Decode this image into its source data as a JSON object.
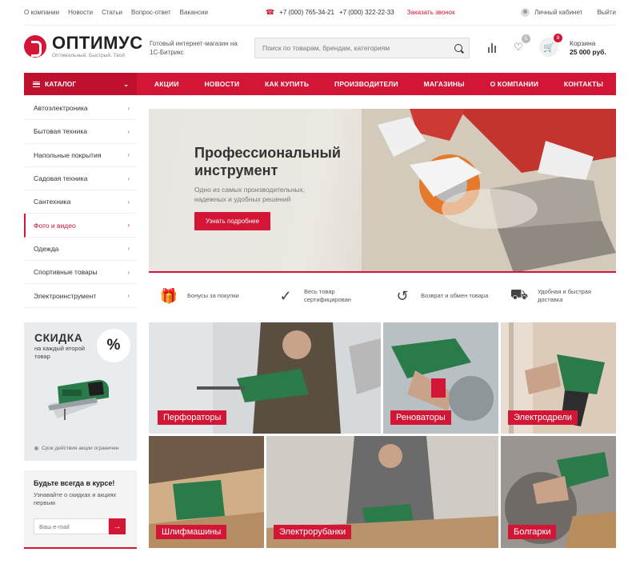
{
  "topbar": {
    "links": [
      "О компании",
      "Новости",
      "Статьи",
      "Вопрос-ответ",
      "Вакансии"
    ],
    "phone1": "+7 (000) 765-34-21",
    "phone2": "+7 (000) 322-22-33",
    "callback": "Заказать звонок",
    "account": "Личный кабинет",
    "logout": "Выйти"
  },
  "header": {
    "logo_name": "ОПТИМУС",
    "logo_slogan": "Оптимальный. Быстрый. Твой",
    "description": "Готовый интернет-магазин на 1С-Битрикс",
    "search_placeholder": "Поиск по товарам, брендам, категориям",
    "fav_count": "5",
    "cart_count": "8",
    "cart_label": "Корзина",
    "cart_total": "25 000 руб."
  },
  "nav": {
    "catalog": "КАТАЛОГ",
    "items": [
      "АКЦИИ",
      "НОВОСТИ",
      "КАК КУПИТЬ",
      "ПРОИЗВОДИТЕЛИ",
      "МАГАЗИНЫ",
      "О КОМПАНИИ",
      "КОНТАКТЫ"
    ]
  },
  "sidebar": {
    "items": [
      "Автоэлектроника",
      "Бытовая техника",
      "Напольные покрытия",
      "Садовая техника",
      "Сантехника",
      "Фото и видео",
      "Одежда",
      "Спортивные товары",
      "Электроинструмент"
    ],
    "active_index": 5
  },
  "promo": {
    "title": "СКИДКА",
    "subtitle": "на каждый второй товар",
    "percent": "%",
    "note": "Срок действия акции ограничен"
  },
  "subscribe": {
    "title": "Будьте всегда в курсе!",
    "text": "Узнавайте о скидках и акциях первым",
    "placeholder": "Ваш e-mail"
  },
  "banner": {
    "title": "Профессиональный инструмент",
    "text": "Одно из самых производительных, надежных и удобных решений",
    "button": "Узнать подробнее"
  },
  "features": [
    {
      "icon": "gift-icon",
      "text": "Бонусы за покупки"
    },
    {
      "icon": "shield-check-icon",
      "text": "Весь товар сертифицирован"
    },
    {
      "icon": "return-clock-icon",
      "text": "Возврат и обмен товара"
    },
    {
      "icon": "truck-icon",
      "text": "Удобная и быстрая доставка"
    }
  ],
  "categories": [
    "Перфораторы",
    "Реноваторы",
    "Электродрели",
    "Шлифмашины",
    "Электрорубанки",
    "Болгарки"
  ],
  "colors": {
    "accent": "#d31536",
    "tool_green": "#2a7a4a"
  }
}
